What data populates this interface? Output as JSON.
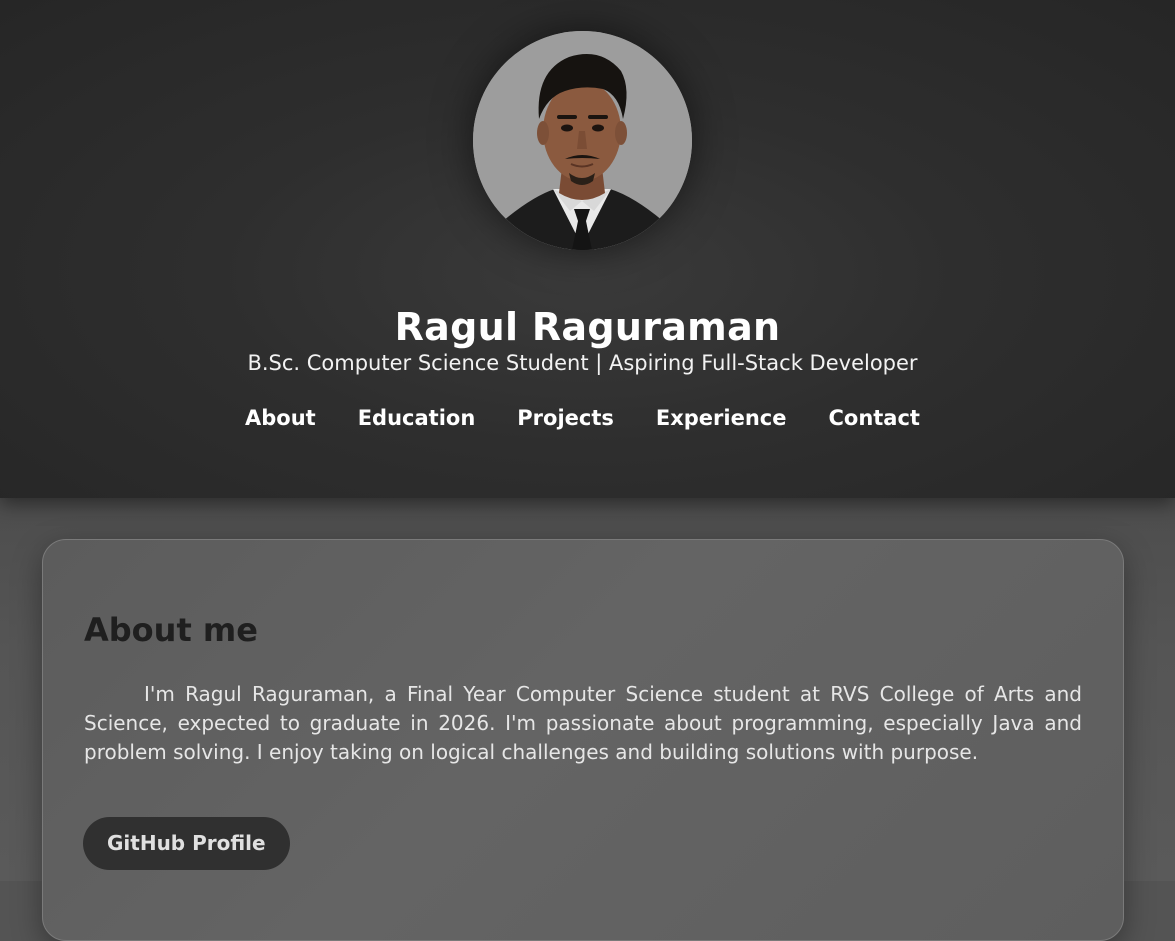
{
  "header": {
    "name": "Ragul Raguraman",
    "tagline": "B.Sc. Computer Science Student | Aspiring Full-Stack Developer",
    "avatar_icon": "profile-photo"
  },
  "nav": {
    "items": [
      {
        "label": "About"
      },
      {
        "label": "Education"
      },
      {
        "label": "Projects"
      },
      {
        "label": "Experience"
      },
      {
        "label": "Contact"
      }
    ]
  },
  "about": {
    "title": "About me",
    "text": "I'm Ragul Raguraman, a Final Year Computer Science student at RVS College of Arts and Science, expected to graduate in 2026. I'm passionate about programming, especially Java and problem solving. I enjoy taking on logical challenges and building solutions with purpose.",
    "github_label": "GitHub Profile"
  },
  "colors": {
    "header_bg": "#2e2e2e",
    "page_bg": "#545454",
    "card_bg": "#616161",
    "button_bg": "#303030",
    "heading_dark": "#1f1f1f"
  }
}
